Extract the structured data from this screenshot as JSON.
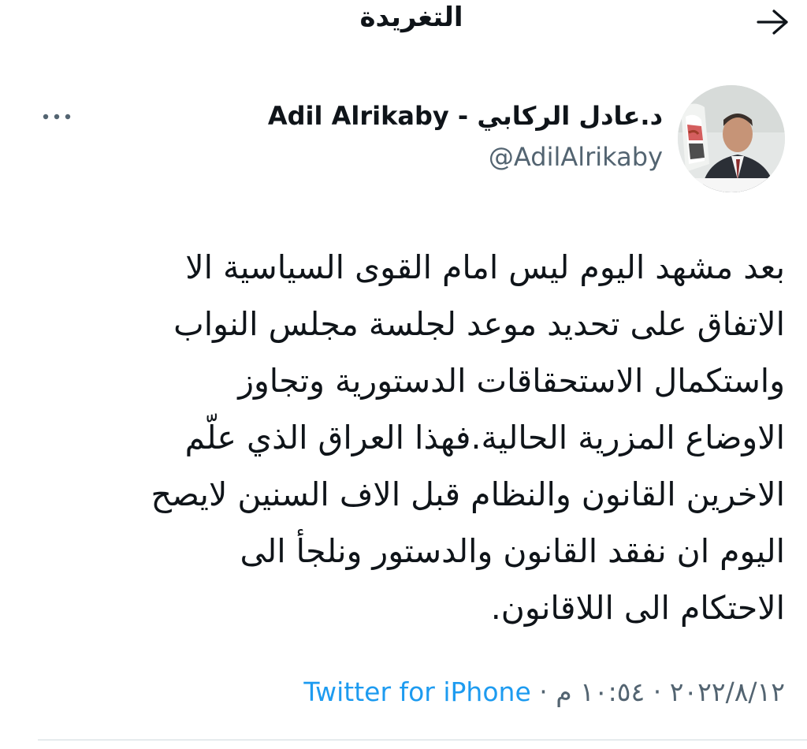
{
  "header": {
    "title": "التغريدة",
    "back_icon": "arrow-forward-icon"
  },
  "author": {
    "display_name": "د.عادل الركابي - Adil Alrikaby",
    "handle": "@AdilAlrikaby",
    "avatar": "avatar-photo"
  },
  "tweet": {
    "text": "بعد مشهد اليوم ليس امام القوى السياسية الا\nالاتفاق على تحديد موعد لجلسة مجلس النواب\nواستكمال الاستحقاقات الدستورية وتجاوز\nالاوضاع المزرية الحالية.فهذا العراق الذي علّم\nالاخرين القانون والنظام قبل الاف السنين لايصح\nاليوم ان نفقد القانون والدستور ونلجأ الى\nالاحتكام الى اللاقانون.",
    "date": "٢٠٢٢/٨/١٢",
    "time": "١٠:٥٤ م",
    "separator": " · ",
    "source": "Twitter for iPhone"
  },
  "colors": {
    "link": "#1d9bf0",
    "muted": "#536471",
    "text": "#0f1419"
  }
}
